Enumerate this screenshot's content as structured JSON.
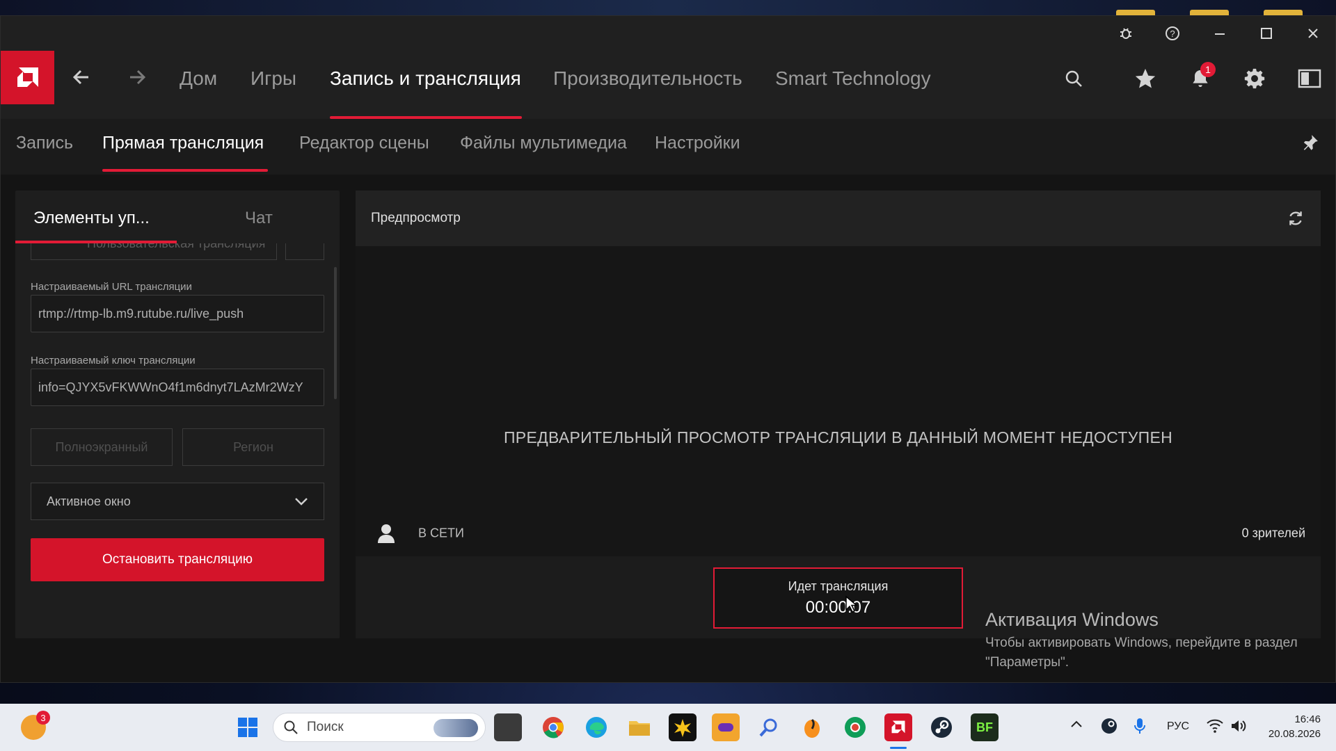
{
  "nav": {
    "items": [
      "Дом",
      "Игры",
      "Запись и трансляция",
      "Производительность",
      "Smart Technology"
    ],
    "notification_count": "1"
  },
  "subnav": {
    "items": [
      "Запись",
      "Прямая трансляция",
      "Редактор сцены",
      "Файлы мультимедиа",
      "Настройки"
    ]
  },
  "left_panel": {
    "tabs": [
      "Элементы уп...",
      "Чат"
    ],
    "custom_stream_label": "Пользовательская трансляция",
    "url_label": "Настраиваемый URL трансляции",
    "url_value": "rtmp://rtmp-lb.m9.rutube.ru/live_push",
    "key_label": "Настраиваемый ключ трансляции",
    "key_value": "info=QJYX5vFKWWnO4f1m6dnyt7LAzMr2WzY",
    "capture_fullscreen": "Полноэкранный",
    "capture_region": "Регион",
    "capture_select": "Активное окно",
    "stop_button": "Остановить трансляцию"
  },
  "preview": {
    "title": "Предпросмотр",
    "unavailable": "ПРЕДВАРИТЕЛЬНЫЙ ПРОСМОТР ТРАНСЛЯЦИИ В ДАННЫЙ МОМЕНТ НЕДОСТУПЕН",
    "online_status": "В СЕТИ",
    "viewers": "0 зрителей",
    "live_title": "Идет трансляция",
    "live_time": "00:00:07"
  },
  "activation": {
    "title": "Активация Windows",
    "text": "Чтобы активировать Windows, перейдите в раздел \"Параметры\"."
  },
  "taskbar": {
    "weather_badge": "3",
    "search_placeholder": "Поиск",
    "language": "РУС",
    "time": "16:46",
    "date": "20.08.2026"
  },
  "colors": {
    "accent": "#e21b36",
    "button_red": "#d4142a",
    "background": "#141414",
    "panel": "#1e1e1e"
  }
}
